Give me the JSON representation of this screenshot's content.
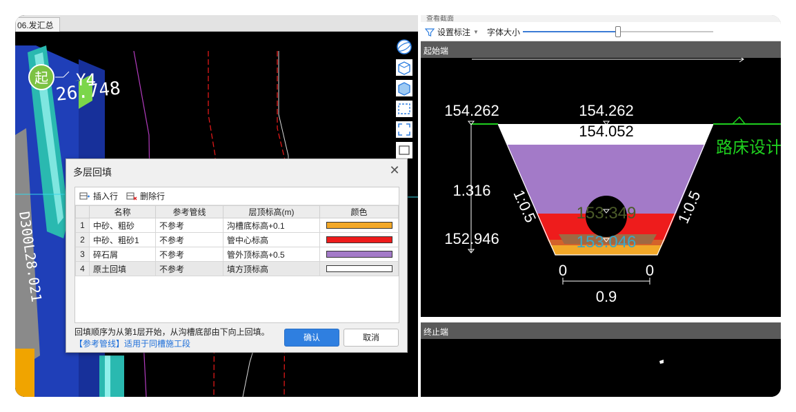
{
  "left_view": {
    "tab_label": "06.发汇总",
    "start_marker": "起",
    "point_label": "Y4",
    "elevation_label": "26.748",
    "pipe_label": "D300L28.021",
    "nav": {
      "icons": [
        "globe-icon",
        "cube-outline-icon",
        "cube-solid-icon",
        "select-rect-icon",
        "fit-view-icon",
        "layers-icon"
      ]
    }
  },
  "dialog": {
    "title": "多层回填",
    "close_glyph": "✕",
    "toolbar": {
      "insert_row": "插入行",
      "delete_row": "删除行"
    },
    "columns": [
      "名称",
      "参考管线",
      "层顶标高(m)",
      "颜色"
    ],
    "rows": [
      {
        "index": "1",
        "name": "中砂、粗砂",
        "reference": "不参考",
        "top_elevation": "沟槽底标高+0.1",
        "color": "#f2a828"
      },
      {
        "index": "2",
        "name": "中砂、粗砂1",
        "reference": "不参考",
        "top_elevation": "管中心标高",
        "color": "#ee1c1c"
      },
      {
        "index": "3",
        "name": "碎石屑",
        "reference": "不参考",
        "top_elevation": "管外顶标高+0.5",
        "color": "#a37ac8"
      },
      {
        "index": "4",
        "name": "原土回填",
        "reference": "不参考",
        "top_elevation": "填方顶标高",
        "color": "#ffffff"
      }
    ],
    "note": "回填顺序为从第1层开始，从沟槽底部由下向上回填。",
    "note_link": "【参考管线】适用于同槽施工段",
    "ok_button": "确认",
    "cancel_button": "取消"
  },
  "right_panel": {
    "top_strip_text": "查看截面",
    "set_annotation": "设置标注",
    "font_size_label": "字体大小",
    "font_size_slider_value": 0.5,
    "start_section": {
      "header": "起始端",
      "left_top_elevation": "154.262",
      "center_top_elevation": "154.262",
      "fill_top_elevation": "154.052",
      "depth": "1.316",
      "bottom_elevation": "152.946",
      "pipe_top_elevation": "153.349",
      "pipe_center_elevation": "153.046",
      "slope_left": "1:0.5",
      "slope_right": "1:0.5",
      "offset_left": "0",
      "offset_right": "0",
      "bottom_width": "0.9",
      "roadbed_label": "路床设计"
    },
    "end_section": {
      "header": "终止端"
    }
  }
}
